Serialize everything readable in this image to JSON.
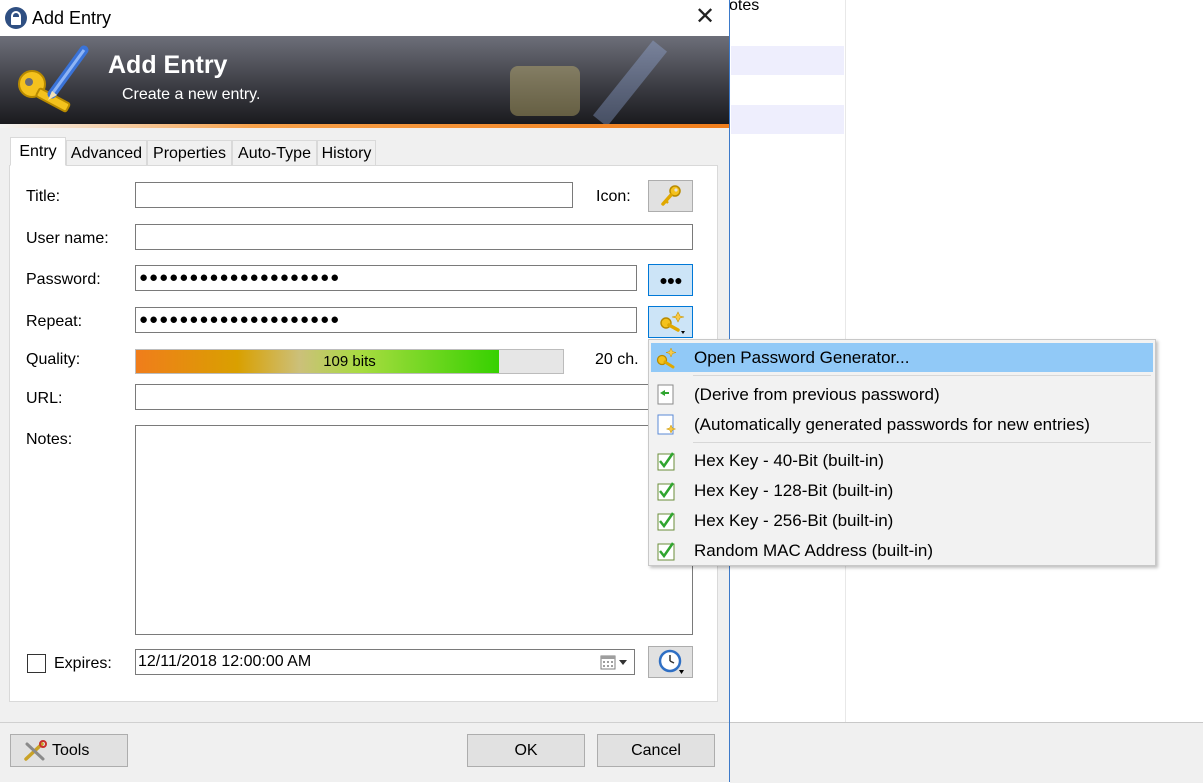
{
  "background": {
    "notes_partial": "otes"
  },
  "window": {
    "title": "Add Entry",
    "close_glyph": "✕"
  },
  "banner": {
    "title": "Add Entry",
    "subtitle": "Create a new entry."
  },
  "tabs": [
    {
      "label": "Entry",
      "active": true
    },
    {
      "label": "Advanced",
      "active": false
    },
    {
      "label": "Properties",
      "active": false
    },
    {
      "label": "Auto-Type",
      "active": false
    },
    {
      "label": "History",
      "active": false
    }
  ],
  "form": {
    "title_label": "Title:",
    "title_value": "",
    "icon_label": "Icon:",
    "username_label": "User name:",
    "username_value": "",
    "password_label": "Password:",
    "password_value": "●●●●●●●●●●●●●●●●●●●●",
    "show_password_glyph": "●●●",
    "repeat_label": "Repeat:",
    "repeat_value": "●●●●●●●●●●●●●●●●●●●●",
    "quality_label": "Quality:",
    "quality_text": "109 bits",
    "quality_fraction": 0.85,
    "quality_chars": "20 ch.",
    "url_label": "URL:",
    "url_value": "",
    "notes_label": "Notes:",
    "notes_value": "",
    "expires_label": "Expires:",
    "expires_checked": false,
    "expires_value": "12/11/2018 12:00:00 AM"
  },
  "footer": {
    "tools_label": "Tools",
    "ok_label": "OK",
    "cancel_label": "Cancel"
  },
  "menu": {
    "items": [
      {
        "label": "Open Password Generator...",
        "icon": "key-generator-icon",
        "highlighted": true
      },
      {
        "label": "(Derive from previous password)",
        "icon": "derive-icon",
        "highlighted": false
      },
      {
        "label": "(Automatically generated passwords for new entries)",
        "icon": "auto-generate-icon",
        "highlighted": false
      },
      {
        "label": "Hex Key - 40-Bit (built-in)",
        "icon": "profile-icon",
        "highlighted": false
      },
      {
        "label": "Hex Key - 128-Bit (built-in)",
        "icon": "profile-icon",
        "highlighted": false
      },
      {
        "label": "Hex Key - 256-Bit (built-in)",
        "icon": "profile-icon",
        "highlighted": false
      },
      {
        "label": "Random MAC Address (built-in)",
        "icon": "profile-icon",
        "highlighted": false
      }
    ]
  },
  "colors": {
    "accent": "#0078d7",
    "menu_highlight": "#91c9f7",
    "banner_orange": "#f07d1b",
    "quality_green": "#36d100"
  }
}
